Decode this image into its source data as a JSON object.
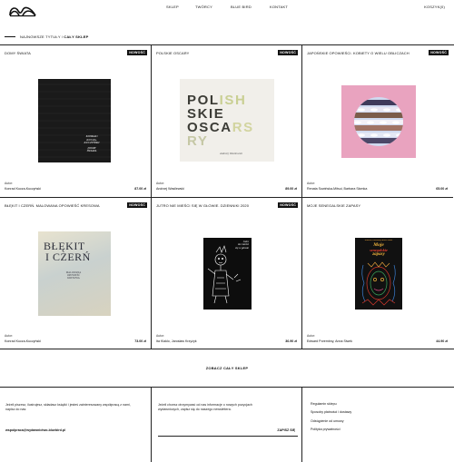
{
  "header": {
    "nav": [
      "SKLEP",
      "TWÓRCY",
      "BLUE BIRD",
      "KONTAKT"
    ],
    "cart": "KOSZYK(0)"
  },
  "breadcrumb": {
    "path": "NAJNOWSZE TYTUŁY /",
    "current": "CAŁY SKLEP"
  },
  "products": [
    {
      "title": "DOMY ŚWIATA",
      "badge": "NOWOŚĆ",
      "author_label": "Autor:",
      "authors": "Konrad Kucza-Kuczyński",
      "price": "87.00 zł",
      "cover_text": [
        "KONRAD",
        "KUCZA-",
        "KUCZYŃSKI",
        "DOMY",
        "ŚWIATA"
      ]
    },
    {
      "title": "POLSKIE OSCARY",
      "badge": "NOWOŚĆ",
      "author_label": "Autor:",
      "authors": "Andrzej Wasilewski",
      "price": "89.00 zł",
      "cover_text": [
        "POLISH",
        "SKIE",
        "OSCARS",
        "RY",
        "Andrzej Wasilewski"
      ]
    },
    {
      "title": "JAPOŃSKIE OPOWIEŚCI. KOBIETY O WIELU OBLICZACH",
      "badge": "NOWOŚĆ",
      "author_label": "Autor:",
      "authors": "Renata Sowińska-Mitsui, Barbara Słomka",
      "price": "65.00 zł"
    },
    {
      "title": "BŁĘKIT I CZERŃ. MALOWANA OPOWIEŚĆ KRESOWA",
      "badge": "NOWOŚĆ",
      "author_label": "Autor:",
      "authors": "Konrad Kucza-Kuczyński",
      "price": "73.00 zł",
      "cover_text": [
        "BŁĘKIT",
        "I CZERŃ",
        "MALOWANA",
        "OPOWIEŚĆ",
        "KRESOWA"
      ]
    },
    {
      "title": "JUTRO NIE MIEŚCI SIĘ W GŁOWIE. DZIENNIKI 2020",
      "badge": "NOWOŚĆ",
      "author_label": "Autor:",
      "authors": "Ita Klaklo, Jarosław Krzyżyk",
      "price": "36.90 zł",
      "cover_text": [
        "Jutro",
        "nie mieści",
        "się w głowie"
      ]
    },
    {
      "title": "MOJE SENEGALSKIE ZAPASY",
      "badge": "",
      "author_label": "Autor:",
      "authors": "Edward Porembny, Anna Siwek",
      "price": "44.90 zł",
      "cover_text": [
        "Edward Porembny, Anna Siwek",
        "Moje",
        "senegalskie",
        "zapasy"
      ]
    }
  ],
  "see_all": "ZOBACZ CAŁY SKLEP",
  "footer": {
    "cooperation_text": "Jeżeli piszesz, ilustrujesz, składasz książki i jesteś zainteresowany współpracą z nami, napisz do nas:",
    "cooperation_email": "wspolpraca@wydawnictwo-bluebird.pl",
    "newsletter_text": "Jeżeli chcesz otrzymywać od nas informacje o nowych pozycjach wydawniczych, zapisz się do naszego newslettera.",
    "newsletter_button": "ZAPISZ SIĘ",
    "links": [
      "Regulamin sklepu",
      "Sposoby płatności i dostawy",
      "Odstąpienie od umowy",
      "Polityka prywatności"
    ]
  }
}
